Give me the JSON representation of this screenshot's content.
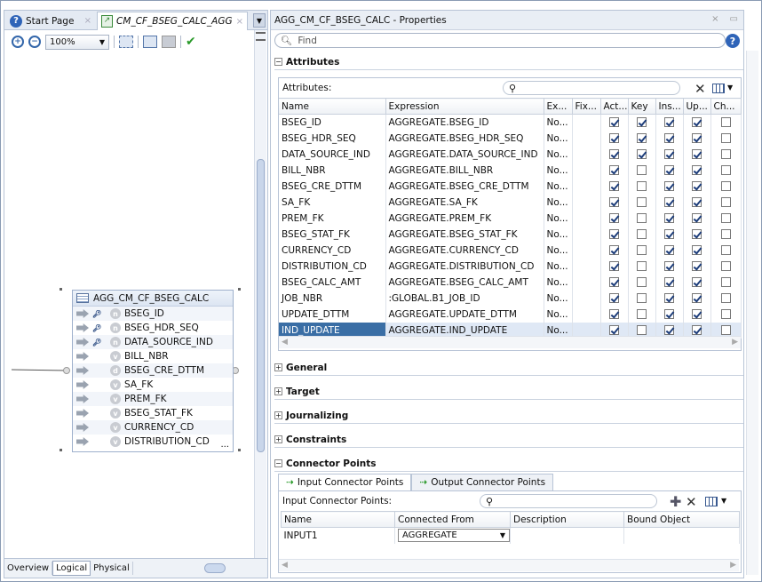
{
  "left_panel": {
    "tabs": [
      {
        "label": "Start Page"
      },
      {
        "label": "CM_CF_BSEG_CALC_AGG"
      }
    ],
    "zoom": "100%",
    "node": {
      "title": "AGG_CM_CF_BSEG_CALC",
      "rows": [
        {
          "label": "BSEG_ID",
          "icon": "key-icon",
          "badge": "n"
        },
        {
          "label": "BSEG_HDR_SEQ",
          "icon": "key-icon",
          "badge": "n"
        },
        {
          "label": "DATA_SOURCE_IND",
          "icon": "key-icon",
          "badge": "n"
        },
        {
          "label": "BILL_NBR",
          "icon": "",
          "badge": "v"
        },
        {
          "label": "BSEG_CRE_DTTM",
          "icon": "",
          "badge": "d"
        },
        {
          "label": "SA_FK",
          "icon": "",
          "badge": "v"
        },
        {
          "label": "PREM_FK",
          "icon": "",
          "badge": "v"
        },
        {
          "label": "BSEG_STAT_FK",
          "icon": "",
          "badge": "v"
        },
        {
          "label": "CURRENCY_CD",
          "icon": "",
          "badge": "v"
        },
        {
          "label": "DISTRIBUTION_CD",
          "icon": "",
          "badge": "v"
        }
      ],
      "more": "..."
    },
    "bottom_tabs": [
      "Overview",
      "Logical",
      "Physical"
    ],
    "active_bottom_tab": "Logical"
  },
  "properties": {
    "title": "AGG_CM_CF_BSEG_CALC - Properties",
    "find_placeholder": "Find",
    "attributes": {
      "section": "Attributes",
      "label": "Attributes:",
      "columns": [
        "Name",
        "Expression",
        "Ex...",
        "Fix...",
        "Act...",
        "Key",
        "Ins...",
        "Up...",
        "Ch..."
      ],
      "rows": [
        {
          "name": "BSEG_ID",
          "expr": "AGGREGATE.BSEG_ID",
          "ex": "No...",
          "act": true,
          "key": true,
          "ins": true,
          "up": true,
          "ch": false
        },
        {
          "name": "BSEG_HDR_SEQ",
          "expr": "AGGREGATE.BSEG_HDR_SEQ",
          "ex": "No...",
          "act": true,
          "key": true,
          "ins": true,
          "up": true,
          "ch": false
        },
        {
          "name": "DATA_SOURCE_IND",
          "expr": "AGGREGATE.DATA_SOURCE_IND",
          "ex": "No...",
          "act": true,
          "key": true,
          "ins": true,
          "up": true,
          "ch": false
        },
        {
          "name": "BILL_NBR",
          "expr": "AGGREGATE.BILL_NBR",
          "ex": "No...",
          "act": true,
          "key": false,
          "ins": true,
          "up": true,
          "ch": false
        },
        {
          "name": "BSEG_CRE_DTTM",
          "expr": "AGGREGATE.BSEG_CRE_DTTM",
          "ex": "No...",
          "act": true,
          "key": false,
          "ins": true,
          "up": true,
          "ch": false
        },
        {
          "name": "SA_FK",
          "expr": "AGGREGATE.SA_FK",
          "ex": "No...",
          "act": true,
          "key": false,
          "ins": true,
          "up": true,
          "ch": false
        },
        {
          "name": "PREM_FK",
          "expr": "AGGREGATE.PREM_FK",
          "ex": "No...",
          "act": true,
          "key": false,
          "ins": true,
          "up": true,
          "ch": false
        },
        {
          "name": "BSEG_STAT_FK",
          "expr": "AGGREGATE.BSEG_STAT_FK",
          "ex": "No...",
          "act": true,
          "key": false,
          "ins": true,
          "up": true,
          "ch": false
        },
        {
          "name": "CURRENCY_CD",
          "expr": "AGGREGATE.CURRENCY_CD",
          "ex": "No...",
          "act": true,
          "key": false,
          "ins": true,
          "up": true,
          "ch": false
        },
        {
          "name": "DISTRIBUTION_CD",
          "expr": "AGGREGATE.DISTRIBUTION_CD",
          "ex": "No...",
          "act": true,
          "key": false,
          "ins": true,
          "up": true,
          "ch": false
        },
        {
          "name": "BSEG_CALC_AMT",
          "expr": "AGGREGATE.BSEG_CALC_AMT",
          "ex": "No...",
          "act": true,
          "key": false,
          "ins": true,
          "up": true,
          "ch": false
        },
        {
          "name": "JOB_NBR",
          "expr": ":GLOBAL.B1_JOB_ID",
          "ex": "No...",
          "act": true,
          "key": false,
          "ins": true,
          "up": true,
          "ch": false
        },
        {
          "name": "UPDATE_DTTM",
          "expr": "AGGREGATE.UPDATE_DTTM",
          "ex": "No...",
          "act": true,
          "key": false,
          "ins": true,
          "up": true,
          "ch": false
        },
        {
          "name": "IND_UPDATE",
          "expr": "AGGREGATE.IND_UPDATE",
          "ex": "No...",
          "act": true,
          "key": false,
          "ins": true,
          "up": true,
          "ch": false
        }
      ],
      "selected_row": "IND_UPDATE"
    },
    "sections": [
      "General",
      "Target",
      "Journalizing",
      "Constraints"
    ],
    "connector": {
      "section": "Connector Points",
      "tabs": [
        "Input Connector Points",
        "Output Connector Points"
      ],
      "label": "Input Connector Points:",
      "columns": [
        "Name",
        "Connected From",
        "Description",
        "Bound Object"
      ],
      "rows": [
        {
          "name": "INPUT1",
          "connected_from": "AGGREGATE",
          "description": "",
          "bound": ""
        }
      ]
    }
  },
  "colors": {
    "selection": "#3a6ea5",
    "accent": "#2f64b8"
  }
}
